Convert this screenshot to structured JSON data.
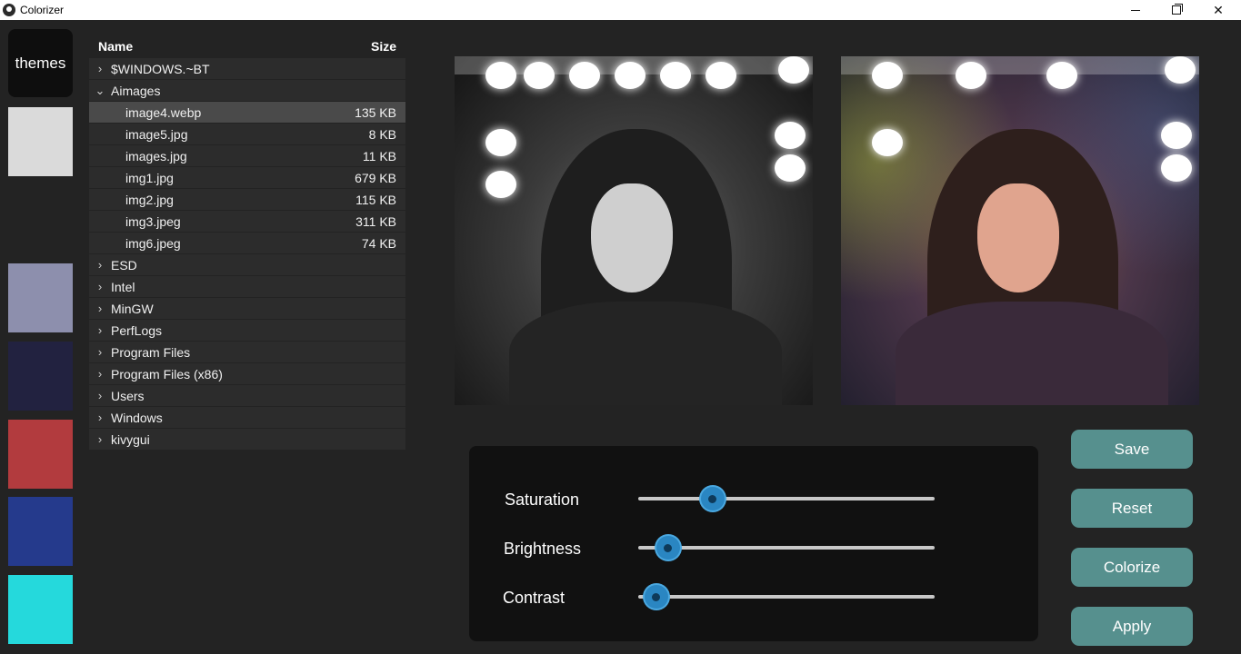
{
  "window": {
    "title": "Colorizer"
  },
  "themes": {
    "label": "themes",
    "swatches": [
      "#dadada",
      "#232323",
      "#8d8fad",
      "#222240",
      "#b23b3e",
      "#253a8c",
      "#25d9dc"
    ]
  },
  "tree": {
    "header": {
      "name": "Name",
      "size": "Size"
    },
    "rows": [
      {
        "type": "folder",
        "name": "$WINDOWS.~BT",
        "expanded": false
      },
      {
        "type": "folder",
        "name": "Aimages",
        "expanded": true
      },
      {
        "type": "file",
        "name": "image4.webp",
        "size": "135 KB",
        "selected": true
      },
      {
        "type": "file",
        "name": "image5.jpg",
        "size": "8 KB"
      },
      {
        "type": "file",
        "name": "images.jpg",
        "size": "11 KB"
      },
      {
        "type": "file",
        "name": "img1.jpg",
        "size": "679 KB"
      },
      {
        "type": "file",
        "name": "img2.jpg",
        "size": "115 KB"
      },
      {
        "type": "file",
        "name": "img3.jpeg",
        "size": "311 KB"
      },
      {
        "type": "file",
        "name": "img6.jpeg",
        "size": "74 KB"
      },
      {
        "type": "folder",
        "name": "ESD",
        "expanded": false
      },
      {
        "type": "folder",
        "name": "Intel",
        "expanded": false
      },
      {
        "type": "folder",
        "name": "MinGW",
        "expanded": false
      },
      {
        "type": "folder",
        "name": "PerfLogs",
        "expanded": false
      },
      {
        "type": "folder",
        "name": "Program Files",
        "expanded": false
      },
      {
        "type": "folder",
        "name": "Program Files (x86)",
        "expanded": false
      },
      {
        "type": "folder",
        "name": "Users",
        "expanded": false
      },
      {
        "type": "folder",
        "name": "Windows",
        "expanded": false
      },
      {
        "type": "folder",
        "name": "kivygui",
        "expanded": false
      }
    ]
  },
  "sliders": [
    {
      "label": "Saturation",
      "value": 0.25
    },
    {
      "label": "Brightness",
      "value": 0.1
    },
    {
      "label": "Contrast",
      "value": 0.06
    }
  ],
  "buttons": {
    "save": "Save",
    "reset": "Reset",
    "colorize": "Colorize",
    "apply": "Apply"
  },
  "colors": {
    "accent_button": "#56908e",
    "knob": "#2a86c2",
    "background": "#232323"
  }
}
